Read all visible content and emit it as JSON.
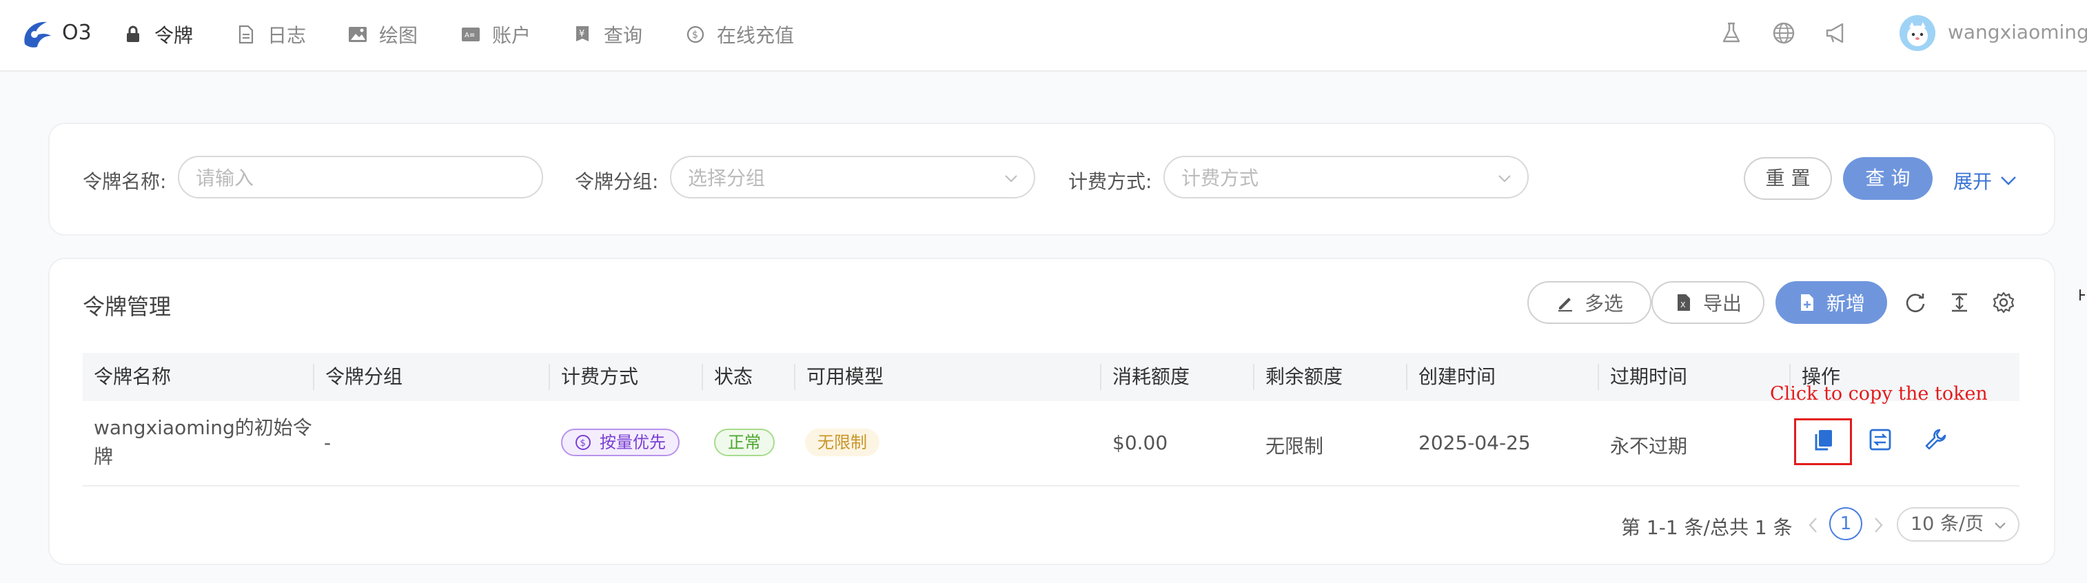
{
  "nav": {
    "brand": "O3",
    "items": [
      {
        "label": "令牌",
        "icon": "lock-icon"
      },
      {
        "label": "日志",
        "icon": "document-icon"
      },
      {
        "label": "绘图",
        "icon": "image-icon"
      },
      {
        "label": "账户",
        "icon": "id-card-icon"
      },
      {
        "label": "查询",
        "icon": "yen-icon"
      },
      {
        "label": "在线充值",
        "icon": "dollar-circle-icon"
      }
    ],
    "right_icons": [
      "flask-icon",
      "globe-icon",
      "megaphone-icon"
    ],
    "username": "wangxiaoming"
  },
  "search": {
    "name_label": "令牌名称:",
    "name_placeholder": "请输入",
    "group_label": "令牌分组:",
    "group_placeholder": "选择分组",
    "billing_label": "计费方式:",
    "billing_placeholder": "计费方式",
    "reset_label": "重 置",
    "query_label": "查 询",
    "expand_label": "展开"
  },
  "table": {
    "title": "令牌管理",
    "toolbar": {
      "multiselect_label": "多选",
      "export_label": "导出",
      "add_label": "新增"
    },
    "columns": [
      "令牌名称",
      "令牌分组",
      "计费方式",
      "状态",
      "可用模型",
      "消耗额度",
      "剩余额度",
      "创建时间",
      "过期时间",
      "操作"
    ],
    "rows": [
      {
        "name_line1": "wangxiaoming的初始令",
        "name_line2": "牌",
        "group": "-",
        "billing": "按量优先",
        "status": "正常",
        "models": "无限制",
        "used": "$0.00",
        "remaining": "无限制",
        "created": "2025-04-25",
        "expires": "永不过期"
      }
    ],
    "annotation": "Click to copy the token"
  },
  "pagination": {
    "summary": "第 1-1 条/总共 1 条",
    "current_page": "1",
    "page_size": "10 条/页"
  },
  "colors": {
    "primary": "#6f96dd",
    "link": "#3b74d6",
    "highlight": "#e31c1c"
  }
}
